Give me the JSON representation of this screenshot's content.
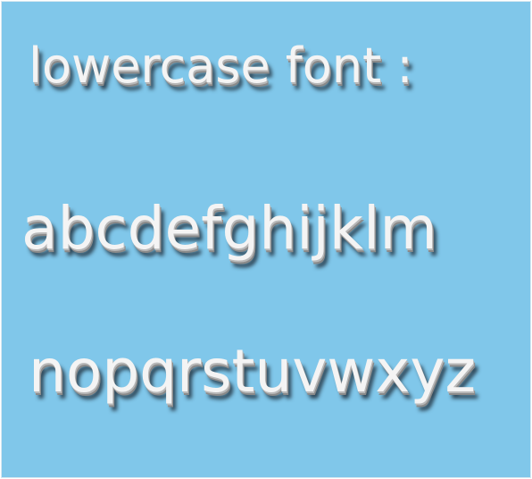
{
  "title": "lowercase font :",
  "rows": [
    "abcdefghijklm",
    "nopqrstuvwxyz"
  ],
  "colors": {
    "background": "#80c7ea",
    "glyph": "#f4f4f4",
    "shadow": "#1e2a34"
  }
}
